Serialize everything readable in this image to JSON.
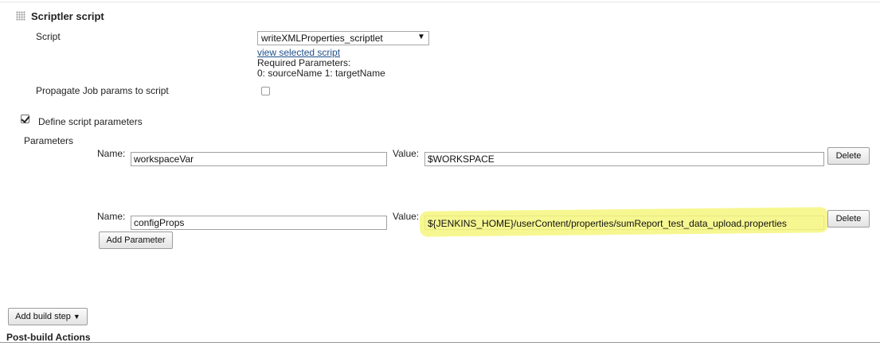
{
  "section": {
    "title": "Scriptler script"
  },
  "script": {
    "label": "Script",
    "selected": "writeXMLProperties_scriptlet",
    "view_link": "view selected script",
    "required_label": "Required Parameters:",
    "required_params": "0: sourceName 1: targetName"
  },
  "propagate": {
    "label": "Propagate Job params to script",
    "checked": false
  },
  "define": {
    "label": "Define script parameters",
    "checked": true
  },
  "parameters": {
    "label": "Parameters",
    "name_label": "Name:",
    "value_label": "Value:",
    "delete_label": "Delete",
    "rows": [
      {
        "name": "workspaceVar",
        "value": "$WORKSPACE"
      },
      {
        "name": "configProps",
        "value": "${JENKINS_HOME}/userContent/properties/sumReport_test_data_upload.properties"
      }
    ],
    "add_label": "Add Parameter"
  },
  "add_build_step": {
    "label": "Add build step"
  },
  "post_build": {
    "title": "Post-build Actions"
  },
  "colors": {
    "highlight": "#f6f67e",
    "link": "#1e4f8a"
  }
}
